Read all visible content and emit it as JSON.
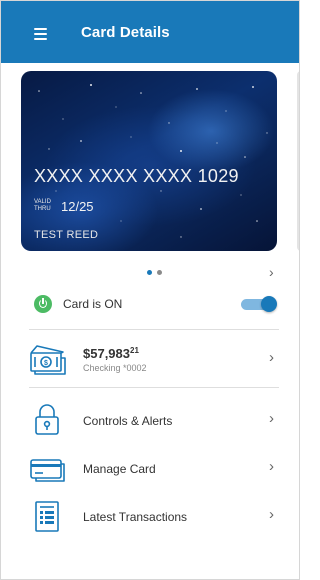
{
  "header": {
    "title": "Card Details",
    "menu_icon": "hamburger-menu-icon",
    "background_color": "#1979b9"
  },
  "card": {
    "number": "XXXX XXXX XXXX 1029",
    "valid_thru_label": "VALID THRU",
    "expiry": "12/25",
    "holder": "TEST REED"
  },
  "pager": {
    "total": 2,
    "active_index": 0,
    "chevron_icon": "chevron-right-icon"
  },
  "card_status": {
    "label": "Card is ON",
    "is_on": true,
    "icon": "power-icon",
    "status_color": "#4cbb64"
  },
  "balance": {
    "amount_main": "$57,983",
    "amount_cents": "21",
    "account": "Checking *0002",
    "icon": "cash-stack-icon"
  },
  "menu_items": [
    {
      "label": "Controls & Alerts",
      "icon": "lock-icon"
    },
    {
      "label": "Manage Card",
      "icon": "card-icon"
    },
    {
      "label": "Latest Transactions",
      "icon": "document-list-icon"
    }
  ]
}
